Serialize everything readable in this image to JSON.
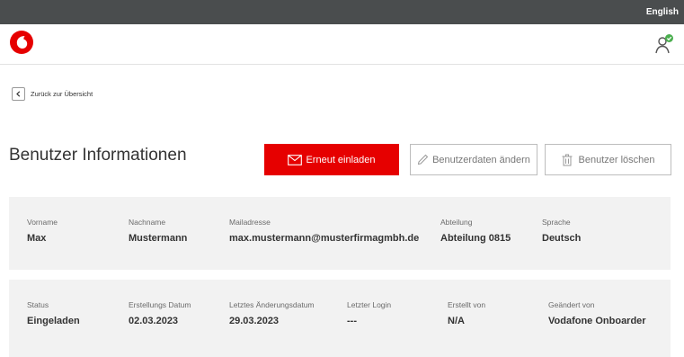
{
  "topbar": {
    "language_link": "English"
  },
  "nav": {
    "back_label": "Zurück zur Übersicht"
  },
  "page": {
    "title": "Benutzer Informationen"
  },
  "actions": {
    "reinvite_label": "Erneut einladen",
    "edit_label": "Benutzerdaten ändern",
    "delete_label": "Benutzer löschen"
  },
  "details": {
    "row1": [
      {
        "label": "Vorname",
        "value": "Max"
      },
      {
        "label": "Nachname",
        "value": "Mustermann"
      },
      {
        "label": "Mailadresse",
        "value": "max.mustermann@musterfirmagmbh.de"
      },
      {
        "label": "Abteilung",
        "value": "Abteilung 0815"
      },
      {
        "label": "Sprache",
        "value": "Deutsch"
      }
    ],
    "row2": [
      {
        "label": "Status",
        "value": "Eingeladen"
      },
      {
        "label": "Erstellungs Datum",
        "value": "02.03.2023"
      },
      {
        "label": "Letztes Änderungsdatum",
        "value": "29.03.2023"
      },
      {
        "label": "Letzter Login",
        "value": "---"
      },
      {
        "label": "Erstellt von",
        "value": "N/A"
      },
      {
        "label": "Geändert von",
        "value": "Vodafone Onboarder"
      }
    ]
  },
  "colors": {
    "brand_red": "#e60000",
    "topbar": "#4a4d4e",
    "panel": "#f2f2f2",
    "badge_green": "#4caf50"
  },
  "icons": [
    "vodafone-logo",
    "user-verified-icon",
    "chevron-left-icon",
    "envelope-icon",
    "pencil-icon",
    "trash-icon"
  ]
}
